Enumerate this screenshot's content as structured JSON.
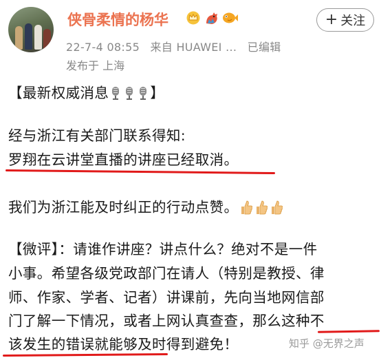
{
  "post": {
    "author": "侠骨柔情的杨华",
    "follow_label": "关注",
    "follow_plus": "+",
    "date": "22-7-4 08:55",
    "source": "来自 HUAWEI ...",
    "edited": "已编辑",
    "location": "发布于 上海",
    "lines": [
      "【最新权威消息",
      "】",
      "经与浙江有关部门联系得知:",
      "罗翔在云讲堂直播的讲座已经取消。",
      "我们为浙江能及时纠正的行动点赞。",
      "【微评】：请谁作讲座？讲点什么？绝对不是一件",
      "小事。希望各级党政部门在请人（特别是教授、律",
      "师、作家、学者、记者）讲课前，先向当地网信部",
      "门了解一下情况，或者上网认真查查，那么这种不",
      "该发生的错误就能够及时得到避免！"
    ]
  },
  "watermark": "知乎 @无界之声",
  "colors": {
    "username": "#eb7350",
    "underline": "#e11a1a",
    "meta": "#888888"
  }
}
